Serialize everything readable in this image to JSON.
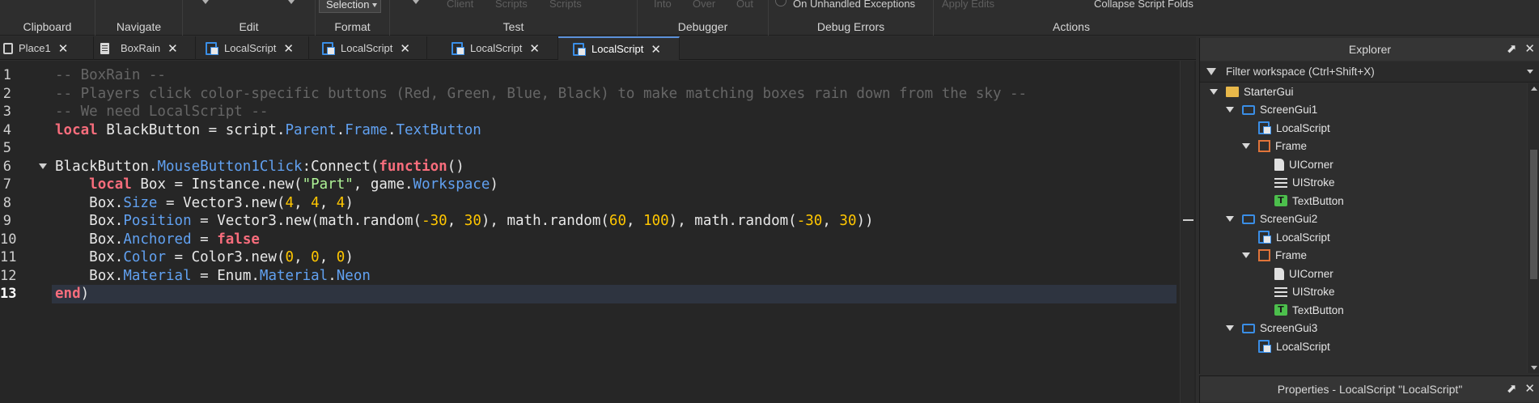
{
  "ribbon": {
    "groups": [
      {
        "label": "Clipboard"
      },
      {
        "label": "Navigate"
      },
      {
        "label": "Edit"
      },
      {
        "label": "Format",
        "selection_label": "Selection"
      },
      {
        "label": "Test",
        "items": [
          "Client",
          "Scripts",
          "Scripts"
        ]
      },
      {
        "label": "Debugger",
        "items": [
          "Into",
          "Over",
          "Out"
        ]
      },
      {
        "label": "Debug Errors",
        "item": "On Unhandled Exceptions"
      },
      {
        "label": "Actions",
        "apply_label": "Apply Edits",
        "collapse_label": "Collapse Script Folds"
      }
    ]
  },
  "tabs": [
    {
      "label": "Place1",
      "icon": "place-icon"
    },
    {
      "label": "BoxRain",
      "icon": "script-icon"
    },
    {
      "label": "LocalScript",
      "icon": "localscript-icon"
    },
    {
      "label": "LocalScript",
      "icon": "localscript-icon"
    },
    {
      "label": "LocalScript",
      "icon": "localscript-icon"
    },
    {
      "label": "LocalScript",
      "icon": "localscript-icon",
      "active": true
    }
  ],
  "editor": {
    "line_numbers": [
      "1",
      "2",
      "3",
      "4",
      "5",
      "6",
      "7",
      "8",
      "9",
      "10",
      "11",
      "12",
      "13"
    ],
    "current_line": 13,
    "code": {
      "l1": "-- BoxRain --",
      "l2": "-- Players click color-specific buttons (Red, Green, Blue, Black) to make matching boxes rain down from the sky --",
      "l3": "-- We need LocalScript --",
      "l4": {
        "kw": "local",
        "a": " BlackButton = script.",
        "p1": "Parent",
        "b": ".",
        "p2": "Frame",
        "c": ".",
        "p3": "TextButton"
      },
      "l6": {
        "a": "BlackButton.",
        "p1": "MouseButton1Click",
        "b": ":Connect(",
        "kw": "function",
        "c": "()"
      },
      "l7": {
        "ind": "    ",
        "kw": "local",
        "a": " Box = Instance.new(",
        "s": "\"Part\"",
        "b": ", game.",
        "p1": "Workspace",
        "c": ")"
      },
      "l8": {
        "ind": "    ",
        "a": "Box.",
        "p1": "Size",
        "b": " = Vector3.new(",
        "n1": "4",
        "s1": ", ",
        "n2": "4",
        "s2": ", ",
        "n3": "4",
        "c": ")"
      },
      "l9": {
        "ind": "    ",
        "a": "Box.",
        "p1": "Position",
        "b": " = Vector3.new(math.random(",
        "n1": "-30",
        "s1": ", ",
        "n2": "30",
        "s2": "), math.random(",
        "n3": "60",
        "s3": ", ",
        "n4": "100",
        "s4": "), math.random(",
        "n5": "-30",
        "s5": ", ",
        "n6": "30",
        "c": "))"
      },
      "l10": {
        "ind": "    ",
        "a": "Box.",
        "p1": "Anchored",
        "b": " = ",
        "kw": "false"
      },
      "l11": {
        "ind": "    ",
        "a": "Box.",
        "p1": "Color",
        "b": " = Color3.new(",
        "n1": "0",
        "s1": ", ",
        "n2": "0",
        "s2": ", ",
        "n3": "0",
        "c": ")"
      },
      "l12": {
        "ind": "    ",
        "a": "Box.",
        "p1": "Material",
        "b": " = Enum.",
        "p2": "Material",
        "c": ".",
        "p3": "Neon"
      },
      "l13": {
        "kw": "end",
        "c": ")"
      }
    }
  },
  "explorer": {
    "title": "Explorer",
    "filter_placeholder": "Filter workspace (Ctrl+Shift+X)",
    "tree": [
      {
        "label": "StarterGui",
        "icon": "folder-icon",
        "depth": 0,
        "expanded": true
      },
      {
        "label": "ScreenGui1",
        "icon": "screengui-icon",
        "depth": 1,
        "expanded": true
      },
      {
        "label": "LocalScript",
        "icon": "localscript-icon",
        "depth": 2
      },
      {
        "label": "Frame",
        "icon": "frame-icon",
        "depth": 2,
        "expanded": true
      },
      {
        "label": "UICorner",
        "icon": "uicorner-icon",
        "depth": 3
      },
      {
        "label": "UIStroke",
        "icon": "uistroke-icon",
        "depth": 3
      },
      {
        "label": "TextButton",
        "icon": "textbutton-icon",
        "depth": 3
      },
      {
        "label": "ScreenGui2",
        "icon": "screengui-icon",
        "depth": 1,
        "expanded": true
      },
      {
        "label": "LocalScript",
        "icon": "localscript-icon",
        "depth": 2
      },
      {
        "label": "Frame",
        "icon": "frame-icon",
        "depth": 2,
        "expanded": true
      },
      {
        "label": "UICorner",
        "icon": "uicorner-icon",
        "depth": 3
      },
      {
        "label": "UIStroke",
        "icon": "uistroke-icon",
        "depth": 3
      },
      {
        "label": "TextButton",
        "icon": "textbutton-icon",
        "depth": 3
      },
      {
        "label": "ScreenGui3",
        "icon": "screengui-icon",
        "depth": 1,
        "expanded": true
      },
      {
        "label": "LocalScript",
        "icon": "localscript-icon",
        "depth": 2
      }
    ]
  },
  "properties": {
    "title": "Properties - LocalScript \"LocalScript\""
  },
  "colors": {
    "keyword": "#f86d7c",
    "property": "#61a1f1",
    "number": "#ffc600",
    "string": "#adf195",
    "comment": "#666666",
    "accent": "#5a8fd8"
  }
}
